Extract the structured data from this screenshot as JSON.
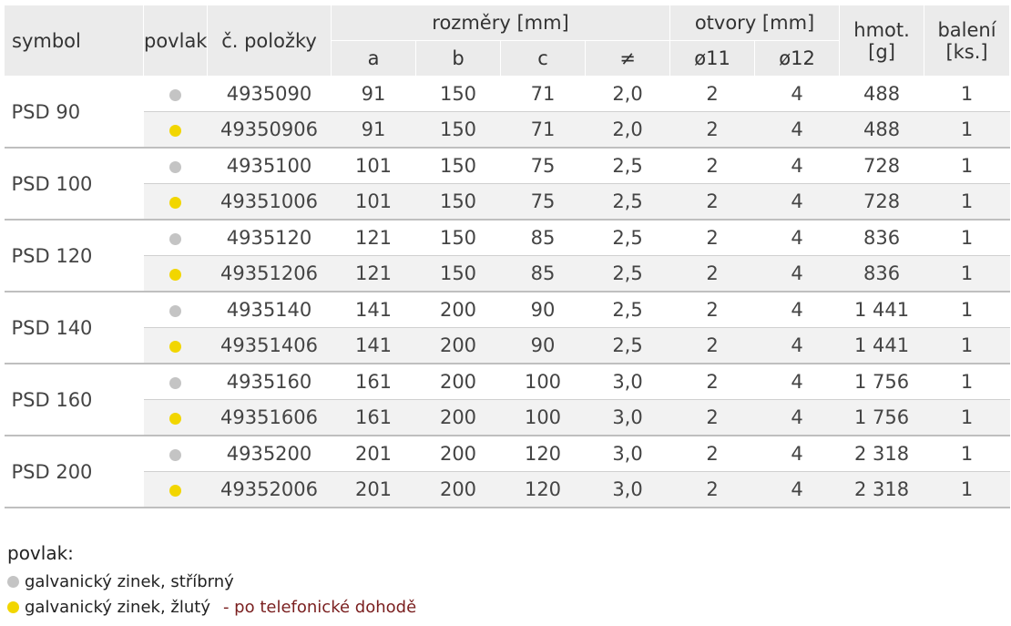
{
  "header": {
    "symbol": "symbol",
    "povlak": "povlak",
    "polozka": "č. položky",
    "rozmery": "rozměry [mm]",
    "otvory": "otvory [mm]",
    "hmot_1": "hmot.",
    "hmot_2": "[g]",
    "baleni_1": "balení",
    "baleni_2": "[ks.]",
    "sub": [
      "a",
      "b",
      "c",
      "≠",
      "ø11",
      "ø12"
    ]
  },
  "colors": {
    "silver": "#c4c4c4",
    "yellow": "#f2d600",
    "note": "#7a1f1f"
  },
  "groups": [
    {
      "symbol": "PSD 90",
      "rows": [
        {
          "coating": "silver",
          "item": "4935090",
          "a": "91",
          "b": "150",
          "c": "71",
          "t": "2,0",
          "o11": "2",
          "o12": "4",
          "weight": "488",
          "pack": "1"
        },
        {
          "coating": "yellow",
          "item": "49350906",
          "a": "91",
          "b": "150",
          "c": "71",
          "t": "2,0",
          "o11": "2",
          "o12": "4",
          "weight": "488",
          "pack": "1"
        }
      ]
    },
    {
      "symbol": "PSD 100",
      "rows": [
        {
          "coating": "silver",
          "item": "4935100",
          "a": "101",
          "b": "150",
          "c": "75",
          "t": "2,5",
          "o11": "2",
          "o12": "4",
          "weight": "728",
          "pack": "1"
        },
        {
          "coating": "yellow",
          "item": "49351006",
          "a": "101",
          "b": "150",
          "c": "75",
          "t": "2,5",
          "o11": "2",
          "o12": "4",
          "weight": "728",
          "pack": "1"
        }
      ]
    },
    {
      "symbol": "PSD 120",
      "rows": [
        {
          "coating": "silver",
          "item": "4935120",
          "a": "121",
          "b": "150",
          "c": "85",
          "t": "2,5",
          "o11": "2",
          "o12": "4",
          "weight": "836",
          "pack": "1"
        },
        {
          "coating": "yellow",
          "item": "49351206",
          "a": "121",
          "b": "150",
          "c": "85",
          "t": "2,5",
          "o11": "2",
          "o12": "4",
          "weight": "836",
          "pack": "1"
        }
      ]
    },
    {
      "symbol": "PSD 140",
      "rows": [
        {
          "coating": "silver",
          "item": "4935140",
          "a": "141",
          "b": "200",
          "c": "90",
          "t": "2,5",
          "o11": "2",
          "o12": "4",
          "weight": "1 441",
          "pack": "1"
        },
        {
          "coating": "yellow",
          "item": "49351406",
          "a": "141",
          "b": "200",
          "c": "90",
          "t": "2,5",
          "o11": "2",
          "o12": "4",
          "weight": "1 441",
          "pack": "1"
        }
      ]
    },
    {
      "symbol": "PSD 160",
      "rows": [
        {
          "coating": "silver",
          "item": "4935160",
          "a": "161",
          "b": "200",
          "c": "100",
          "t": "3,0",
          "o11": "2",
          "o12": "4",
          "weight": "1 756",
          "pack": "1"
        },
        {
          "coating": "yellow",
          "item": "49351606",
          "a": "161",
          "b": "200",
          "c": "100",
          "t": "3,0",
          "o11": "2",
          "o12": "4",
          "weight": "1 756",
          "pack": "1"
        }
      ]
    },
    {
      "symbol": "PSD 200",
      "rows": [
        {
          "coating": "silver",
          "item": "4935200",
          "a": "201",
          "b": "200",
          "c": "120",
          "t": "3,0",
          "o11": "2",
          "o12": "4",
          "weight": "2 318",
          "pack": "1"
        },
        {
          "coating": "yellow",
          "item": "49352006",
          "a": "201",
          "b": "200",
          "c": "120",
          "t": "3,0",
          "o11": "2",
          "o12": "4",
          "weight": "2 318",
          "pack": "1"
        }
      ]
    }
  ],
  "legend": {
    "title": "povlak:",
    "silver_label": "galvanický zinek, stříbrný",
    "yellow_label": "galvanický zinek, žlutý",
    "yellow_note": "- po telefonické dohodě"
  }
}
